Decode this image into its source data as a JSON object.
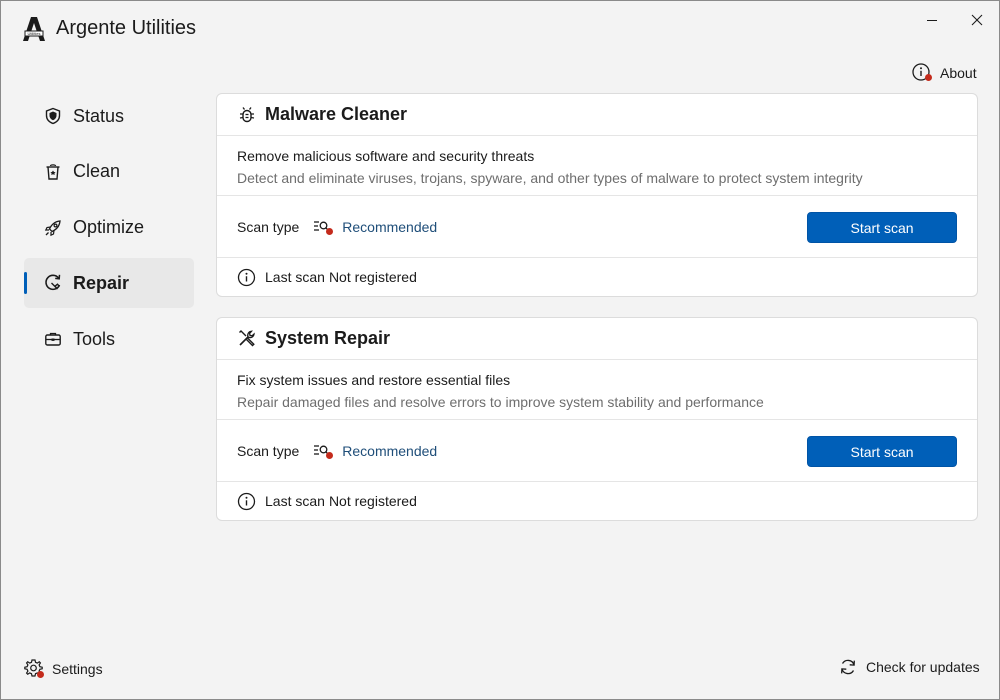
{
  "window": {
    "title": "Argente Utilities",
    "logo_text": "Utilities",
    "icons": [
      "app-logo",
      "minimize-icon",
      "close-icon"
    ]
  },
  "header": {
    "about_label": "About",
    "about_icon": "info-icon"
  },
  "sidebar": {
    "items": [
      {
        "label": "Status",
        "icon": "shield-icon",
        "active": false
      },
      {
        "label": "Clean",
        "icon": "trash-icon",
        "active": false
      },
      {
        "label": "Optimize",
        "icon": "rocket-icon",
        "active": false
      },
      {
        "label": "Repair",
        "icon": "repair-icon",
        "active": true
      },
      {
        "label": "Tools",
        "icon": "toolbox-icon",
        "active": false
      }
    ]
  },
  "cards": [
    {
      "title": "Malware Cleaner",
      "icon": "bug-icon",
      "description": "Remove malicious software and security threats",
      "subdescription": "Detect and eliminate viruses, trojans, spyware, and other types of malware to protect system integrity",
      "scan_type_label": "Scan type",
      "scan_type_value": "Recommended",
      "button_label": "Start scan",
      "last_scan_label": "Last scan",
      "last_scan_value": "Not registered"
    },
    {
      "title": "System Repair",
      "icon": "tools-icon",
      "description": "Fix system issues and restore essential files",
      "subdescription": "Repair damaged files and resolve errors to improve system stability and performance",
      "scan_type_label": "Scan type",
      "scan_type_value": "Recommended",
      "button_label": "Start scan",
      "last_scan_label": "Last scan",
      "last_scan_value": "Not registered"
    }
  ],
  "footer": {
    "settings_label": "Settings",
    "updates_label": "Check for updates"
  },
  "colors": {
    "accent": "#005fb8",
    "notification_dot": "#c42b1c",
    "background": "#f3f3f3",
    "card": "#ffffff"
  }
}
